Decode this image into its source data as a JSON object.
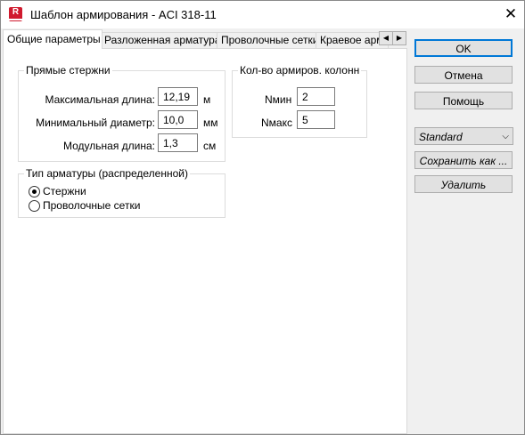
{
  "window": {
    "title": "Шаблон армирования - ACI 318-11",
    "app_icon_letter": "R",
    "close_glyph": "✕"
  },
  "tabs": [
    {
      "label": "Общие параметры",
      "active": true
    },
    {
      "label": "Разложенная арматура",
      "active": false
    },
    {
      "label": "Проволочные сетки",
      "active": false
    },
    {
      "label": "Краевое арм",
      "active": false
    }
  ],
  "tab_scroll": {
    "left": "◀",
    "right": "▶"
  },
  "straight_bars": {
    "title": "Прямые стержни",
    "rows": [
      {
        "label": "Максимальная длина:",
        "value": "12,19",
        "unit": "м"
      },
      {
        "label": "Минимальный диаметр:",
        "value": "10,0",
        "unit": "мм"
      },
      {
        "label": "Модульная длина:",
        "value": "1,3",
        "unit": "см"
      }
    ]
  },
  "columns": {
    "title": "Кол-во армиров. колонн",
    "rows": [
      {
        "label": "Nмин",
        "value": "2"
      },
      {
        "label": "Nмакс",
        "value": "5"
      }
    ]
  },
  "rebar_type": {
    "title": "Тип арматуры (распределенной)",
    "options": [
      {
        "label": "Стержни",
        "checked": true
      },
      {
        "label": "Проволочные сетки",
        "checked": false
      }
    ]
  },
  "buttons": {
    "ok": "OK",
    "cancel": "Отмена",
    "help": "Помощь",
    "save_as": "Сохранить как ...",
    "delete": "Удалить"
  },
  "template_select": {
    "value": "Standard",
    "chevron": "⌵"
  },
  "colors": {
    "accent": "#0078d7",
    "app_icon": "#d01a2e"
  }
}
